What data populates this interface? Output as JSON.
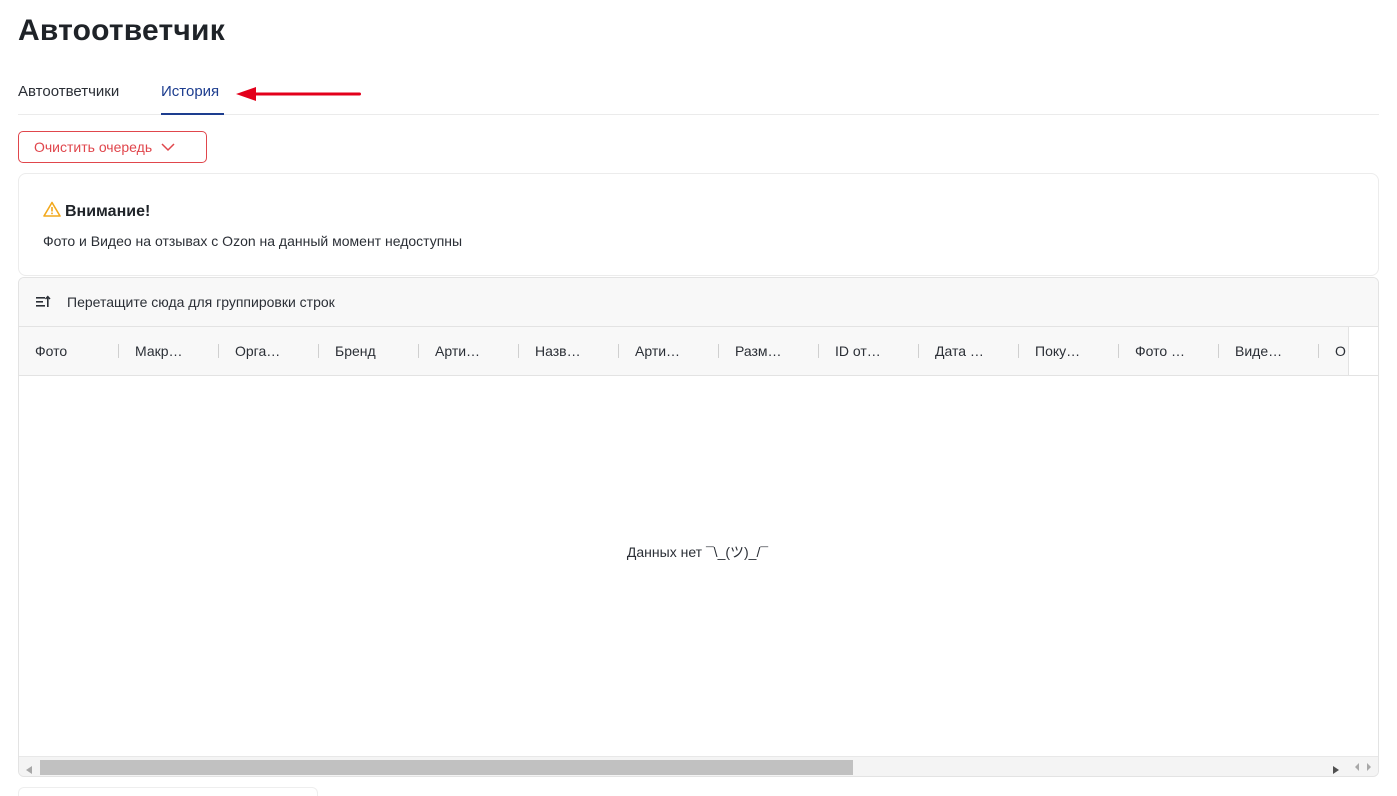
{
  "page": {
    "title": "Автоответчик"
  },
  "tabs": [
    {
      "label": "Автоответчики",
      "active": false
    },
    {
      "label": "История",
      "active": true
    }
  ],
  "toolbar": {
    "clear_queue_label": "Очистить очередь"
  },
  "alert": {
    "title": "Внимание!",
    "text": "Фото и Видео на отзывах с Ozon на данный момент недоступны"
  },
  "grid": {
    "group_hint": "Перетащите сюда для группировки строк",
    "columns": [
      "Фото",
      "Макр…",
      "Орга…",
      "Бренд",
      "Арти…",
      "Назв…",
      "Арти…",
      "Разм…",
      "ID от…",
      "Дата …",
      "Поку…",
      "Фото …",
      "Виде…",
      "О"
    ],
    "empty_text": "Данных нет ¯\\_(ツ)_/¯"
  },
  "colors": {
    "accent": "#1d3d8f",
    "danger": "#e0464c",
    "warning": "#f2a81d",
    "annotation_arrow": "#e3001b"
  },
  "icons": {
    "alert": "warning-triangle-icon",
    "group_by": "group-rows-icon",
    "dropdown": "chevron-down-icon"
  }
}
